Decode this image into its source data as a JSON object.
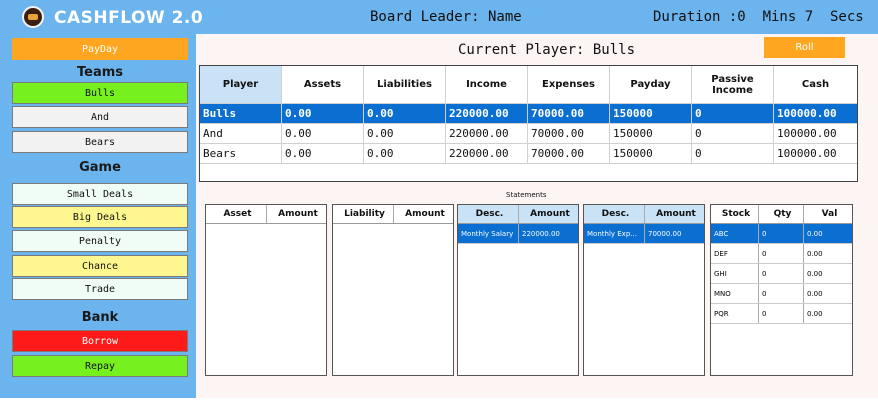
{
  "header": {
    "app_title": "CASHFLOW 2.0",
    "board_leader": "Board Leader: Name",
    "duration": "Duration :0  Mins 7  Secs"
  },
  "sidebar": {
    "payday_label": "PayDay",
    "teams_heading": "Teams",
    "teams": [
      "Bulls",
      "And",
      "Bears"
    ],
    "game_heading": "Game",
    "game_items": [
      "Small Deals",
      "Big Deals",
      "Penalty",
      "Chance",
      "Trade"
    ],
    "bank_heading": "Bank",
    "bank_items": [
      "Borrow",
      "Repay"
    ]
  },
  "main": {
    "current_player": "Current Player: Bulls",
    "roll_label": "Roll",
    "players_table": {
      "columns": [
        "Player",
        "Assets",
        "Liabilities",
        "Income",
        "Expenses",
        "Payday",
        "Passive Income",
        "Cash"
      ],
      "rows": [
        [
          "Bulls",
          "0.00",
          "0.00",
          "220000.00",
          "70000.00",
          "150000",
          "0",
          "100000.00"
        ],
        [
          "And",
          "0.00",
          "0.00",
          "220000.00",
          "70000.00",
          "150000",
          "0",
          "100000.00"
        ],
        [
          "Bears",
          "0.00",
          "0.00",
          "220000.00",
          "70000.00",
          "150000",
          "0",
          "100000.00"
        ]
      ]
    },
    "statements_label": "Statements",
    "assets_table": {
      "columns": [
        "Asset",
        "Amount"
      ],
      "rows": []
    },
    "liabilities_table": {
      "columns": [
        "Liability",
        "Amount"
      ],
      "rows": []
    },
    "income_table": {
      "columns": [
        "Desc.",
        "Amount"
      ],
      "rows": [
        [
          "Monthly Salary",
          "220000.00"
        ]
      ]
    },
    "expenses_table": {
      "columns": [
        "Desc.",
        "Amount"
      ],
      "rows": [
        [
          "Monthly Exp...",
          "70000.00"
        ]
      ]
    },
    "stocks_table": {
      "columns": [
        "Stock",
        "Qty",
        "Val"
      ],
      "rows": [
        [
          "ABC",
          "0",
          "0.00"
        ],
        [
          "DEF",
          "0",
          "0.00"
        ],
        [
          "GHI",
          "0",
          "0.00"
        ],
        [
          "MNO",
          "0",
          "0.00"
        ],
        [
          "PQR",
          "0",
          "0.00"
        ]
      ]
    }
  },
  "colors": {
    "sidebar_bg": "#6cb4ee",
    "payday": "#ffa51f",
    "team_selected": "#76f11f",
    "highlight_yellow": "#fef790",
    "light_cell": "#f0fdf6",
    "borrow": "#ff1a1a",
    "repay": "#76f11f",
    "selection": "#0a6fd1",
    "main_bg": "#fdf4f4"
  }
}
